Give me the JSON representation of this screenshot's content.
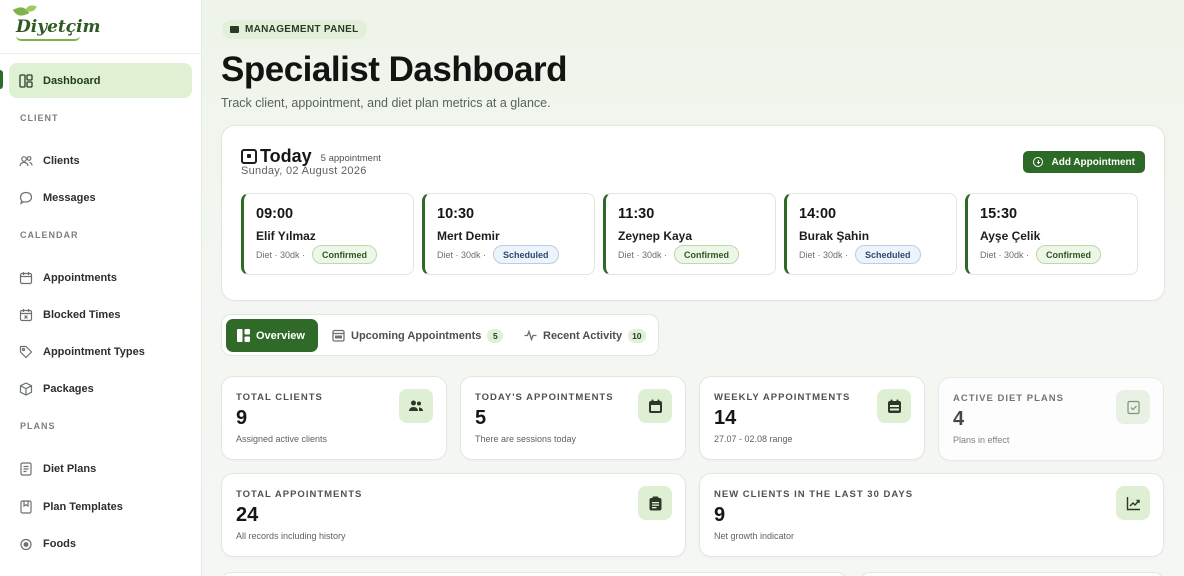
{
  "brand": {
    "logo_text": "Diyetçim"
  },
  "sidebar": {
    "dashboard": "Dashboard",
    "section_client": "CLIENT",
    "clients": "Clients",
    "messages": "Messages",
    "section_calendar": "CALENDAR",
    "appointments": "Appointments",
    "blocked_times": "Blocked Times",
    "appointment_types": "Appointment Types",
    "packages": "Packages",
    "section_plans": "PLANS",
    "diet_plans": "Diet Plans",
    "plan_templates": "Plan Templates",
    "foods": "Foods"
  },
  "header": {
    "badge": "MANAGEMENT PANEL",
    "title": "Specialist Dashboard",
    "subtitle": "Track client, appointment, and diet plan metrics at a glance."
  },
  "today": {
    "title": "Today",
    "count": "5 appointment",
    "date": "Sunday, 02 August 2026",
    "add_button": "Add Appointment",
    "appointments": [
      {
        "time": "09:00",
        "name": "Elif Yılmaz",
        "meta": "Diet · 30dk ·",
        "status": "Confirmed"
      },
      {
        "time": "10:30",
        "name": "Mert Demir",
        "meta": "Diet · 30dk ·",
        "status": "Scheduled"
      },
      {
        "time": "11:30",
        "name": "Zeynep Kaya",
        "meta": "Diet · 30dk ·",
        "status": "Confirmed"
      },
      {
        "time": "14:00",
        "name": "Burak Şahin",
        "meta": "Diet · 30dk ·",
        "status": "Scheduled"
      },
      {
        "time": "15:30",
        "name": "Ayşe Çelik",
        "meta": "Diet · 30dk ·",
        "status": "Confirmed"
      }
    ]
  },
  "tabs": {
    "overview": "Overview",
    "upcoming": "Upcoming Appointments",
    "upcoming_count": "5",
    "activity": "Recent Activity",
    "activity_count": "10"
  },
  "stats": {
    "total_clients": {
      "label": "TOTAL CLIENTS",
      "value": "9",
      "desc": "Assigned active clients"
    },
    "todays_appointments": {
      "label": "TODAY'S APPOINTMENTS",
      "value": "5",
      "desc": "There are sessions today"
    },
    "weekly_appointments": {
      "label": "WEEKLY APPOINTMENTS",
      "value": "14",
      "desc": "27.07  -  02.08 range"
    },
    "active_diet_plans": {
      "label": "ACTIVE DIET PLANS",
      "value": "4",
      "desc": "Plans in effect"
    },
    "total_appointments": {
      "label": "TOTAL APPOINTMENTS",
      "value": "24",
      "desc": "All records including history"
    },
    "new_clients": {
      "label": "NEW CLIENTS IN THE LAST 30 DAYS",
      "value": "9",
      "desc": "Net growth indicator"
    }
  },
  "colors": {
    "accent": "#2d6a27",
    "accent_soft": "#dff0d3",
    "confirmed": "#2a5a22",
    "scheduled": "#2c4b72"
  }
}
